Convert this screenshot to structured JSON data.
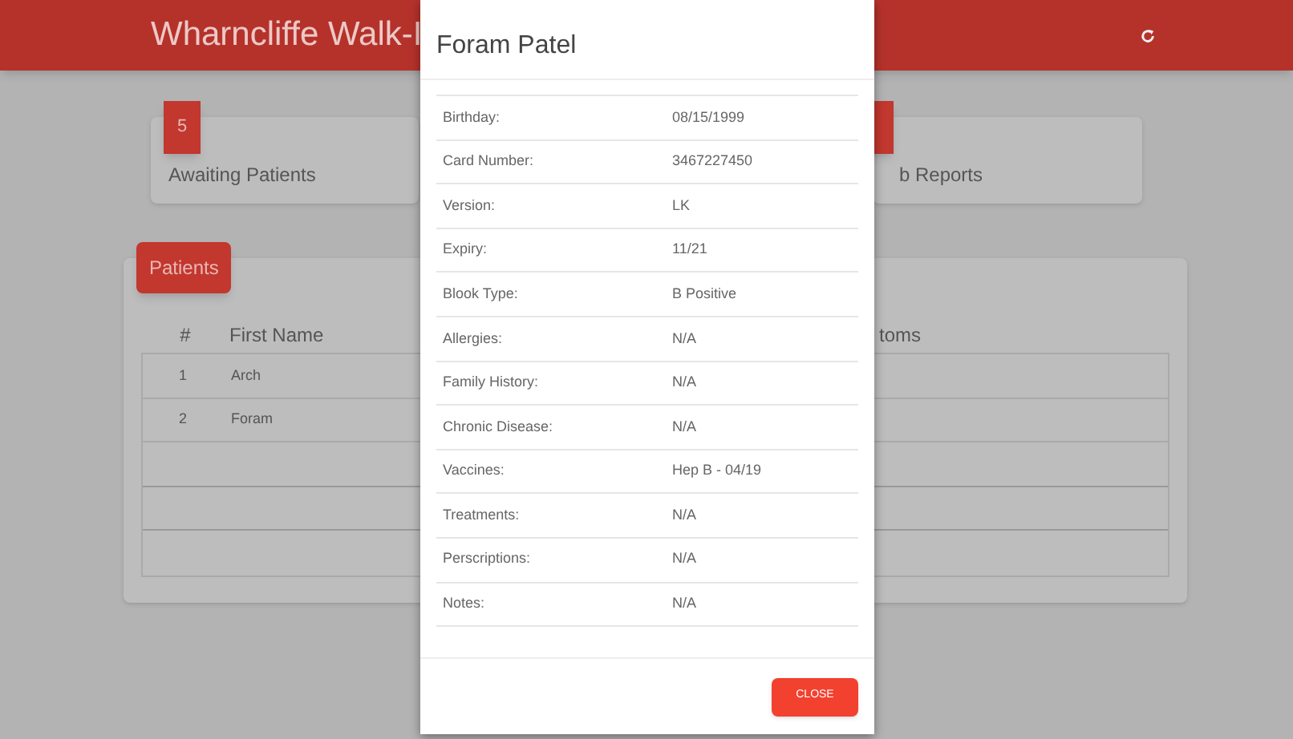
{
  "header": {
    "title": "Wharncliffe Walk-I"
  },
  "stats": [
    {
      "count": "5",
      "label": "Awaiting Patients"
    },
    {
      "label": "b Reports"
    }
  ],
  "patients": {
    "tab": "Patients",
    "columns": [
      "#",
      "First Name",
      "toms"
    ],
    "rows": [
      [
        "1",
        "Arch"
      ],
      [
        "2",
        "Foram"
      ],
      [],
      [],
      []
    ]
  },
  "modal": {
    "title": "Foram Patel",
    "fields": [
      {
        "label": "Birthday:",
        "value": "08/15/1999"
      },
      {
        "label": "Card Number:",
        "value": "3467227450"
      },
      {
        "label": "Version:",
        "value": "LK"
      },
      {
        "label": "Expiry:",
        "value": "11/21"
      },
      {
        "label": "Blook Type:",
        "value": "B Positive"
      },
      {
        "label": "Allergies:",
        "value": "N/A"
      },
      {
        "label": "Family History:",
        "value": "N/A"
      },
      {
        "label": "Chronic Disease:",
        "value": "N/A"
      },
      {
        "label": "Vaccines:",
        "value": "Hep B - 04/19"
      },
      {
        "label": "Treatments:",
        "value": "N/A"
      },
      {
        "label": "Perscriptions:",
        "value": "N/A"
      },
      {
        "label": "Notes:",
        "value": "N/A"
      }
    ],
    "button": "CLOSE"
  }
}
